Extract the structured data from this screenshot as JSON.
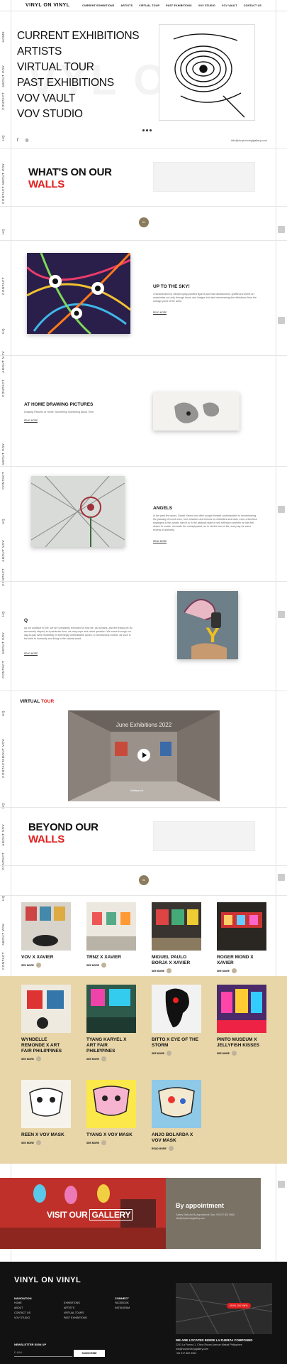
{
  "header": {
    "logo": "VINYL ON VINYL",
    "nav": [
      "CURRENT EXHIBITIONS",
      "ARTISTS",
      "VIRTUAL TOUR",
      "PAST EXHIBITIONS",
      "VOV STUDIO",
      "VOV VAULT",
      "CONTACT US"
    ]
  },
  "rail": {
    "home": "HOME",
    "about": "ABOUT VOV",
    "contact": "CONTACT",
    "hq": "HQ"
  },
  "hero": {
    "menu": [
      "CURRENT EXHIBITIONS",
      "ARTISTS",
      "VIRTUAL TOUR",
      "PAST EXHIBITIONS",
      "VOV VAULT",
      "VOV STUDIO"
    ],
    "email": "info@vinylonvinylgallery.com",
    "watermark": "VYL ON"
  },
  "whats_on": {
    "line1": "WHAT'S ON OUR",
    "line2": "WALLS",
    "counter": "01"
  },
  "exhibitions": [
    {
      "title": "UP TO THE SKY!",
      "desc": "Characterized by vibrant spray-painted figures and bold abstractions, graffiti and street art materialize not only through forms and images but also interweaving the reflections from the outrage point of the artist.",
      "more": "READ MORE"
    },
    {
      "title": "AT HOME DRAWING PICTURES",
      "desc": "Drawing Pictures at Home. Something Something About Time.",
      "more": "READ MORE"
    },
    {
      "title": "ANGELS",
      "desc": "In the past few years, Daniel Yanes has often sought himself contemplative in remembering the passing of loved ones, from relatives and friends to celebrities and idols, even a timeless strategies in this newer mind it is in the abstract state of self reflection wherein he has felt drawn to create, reconcile the metaphysical, an in via the loss of life, and pray for some excess of authority.",
      "more": "READ MORE"
    },
    {
      "title": "Q",
      "desc": "As we continue to live, we are constantly reminded of how we, as humans, and the things we do are merely stayed, at a particular time, we may cope and resist question. We crave through our day-to-day lives mindlessly in seemingly unbreakable cycles; a monotonous routine, as such is the truth to humanity and living in the natural world.",
      "more": "READ MORE"
    }
  ],
  "virtual": {
    "word1": "VIRTUAL",
    "word2": "TOUR",
    "video_title": "June Exhibitions 2022",
    "brand": "Matterport"
  },
  "beyond": {
    "line1": "BEYOND OUR",
    "line2": "WALLS",
    "counter": "02"
  },
  "cards": [
    {
      "title": "VOV X XAVIER",
      "more": "SEE MORE"
    },
    {
      "title": "TRNZ X XAVIER",
      "more": "SEE MORE"
    },
    {
      "title": "MIGUEL PAULO BORJA X XAVIER",
      "more": "SEE MORE"
    },
    {
      "title": "ROGER MOND X XAVIER",
      "more": "SEE MORE"
    },
    {
      "title": "WYNDELLE REMONDE X ART FAIR PHILIPPINES",
      "more": "SEE MORE"
    },
    {
      "title": "TYANG KARYEL X ART FAIR PHILIPPINES",
      "more": "SEE MORE"
    },
    {
      "title": "BITTO X EYE OF THE STORM",
      "more": "SEE MORE"
    },
    {
      "title": "PINTO MUSEUM X JELLYFISH KISSES",
      "more": "SEE MORE"
    },
    {
      "title": "REEN X VOV MASK",
      "more": "SEE MORE"
    },
    {
      "title": "TYANG X VOV MASK",
      "more": "SEE MORE"
    },
    {
      "title": "ANJO BOLARDA X VOV MASK",
      "more": "READ MORE"
    }
  ],
  "gallery": {
    "visit1": "VISIT OUR",
    "visit2": "GALLERY",
    "appt": "By appointment",
    "appt_sub": "Gallery Visits Are By Appointment Only. +63 917 802 3964 / info@vinylonvinylgallery.com"
  },
  "footer": {
    "logo": "VINYL ON VINYL",
    "nav_head": "NAVIGATION",
    "nav_col1": [
      "HOME",
      "ABOUT",
      "CONTACT US",
      "VOV STUDIO"
    ],
    "nav_col2": [
      "EXHIBITIONS",
      "ARTISTS",
      "VIRTUAL TOURS",
      "PAST EXHIBITIONS"
    ],
    "connect_head": "CONNECT",
    "connect": [
      "FACEBOOK",
      "INSTAGRAM"
    ],
    "news_head": "NEWSLETTER SIGN UP",
    "email_ph": "E-MAIL",
    "subscribe": "SUBSCRIBE",
    "loc_head": "WE ARE LOCATED INSIDE LA FUERZA COMPOUND",
    "loc1": "2241 La Fuerza 1, Chino Roces Avenue Makati Philippines",
    "loc2": "info@vinylonvinylgallery.com",
    "loc3": "+63 917 802 3964",
    "map_pin": "VINYL ON VINYL"
  },
  "colors": {
    "accent": "#e0201f",
    "beige": "#e8d6a9",
    "footer": "#121212"
  }
}
